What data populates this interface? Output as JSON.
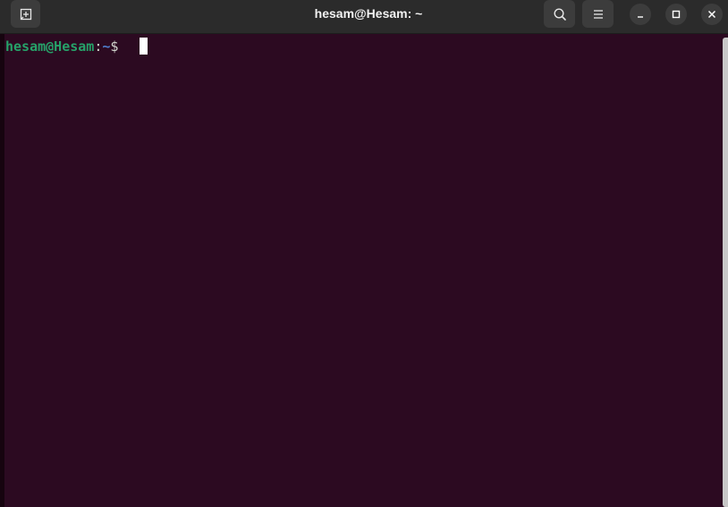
{
  "window": {
    "title": "hesam@Hesam: ~"
  },
  "toolbar": {
    "new_tab_icon": "new-tab-icon",
    "search_icon": "search-icon",
    "menu_icon": "hamburger-menu-icon"
  },
  "controls": {
    "minimize_icon": "minimize-icon",
    "maximize_icon": "maximize-icon",
    "close_icon": "close-icon"
  },
  "terminal": {
    "prompt_user": "hesam@Hesam",
    "prompt_colon": ":",
    "prompt_path": "~",
    "prompt_symbol": "$ "
  },
  "colors": {
    "background": "#2c0a21",
    "titlebar": "#2b2b2b",
    "prompt_user": "#26a269",
    "prompt_path": "#4f7fcf"
  }
}
